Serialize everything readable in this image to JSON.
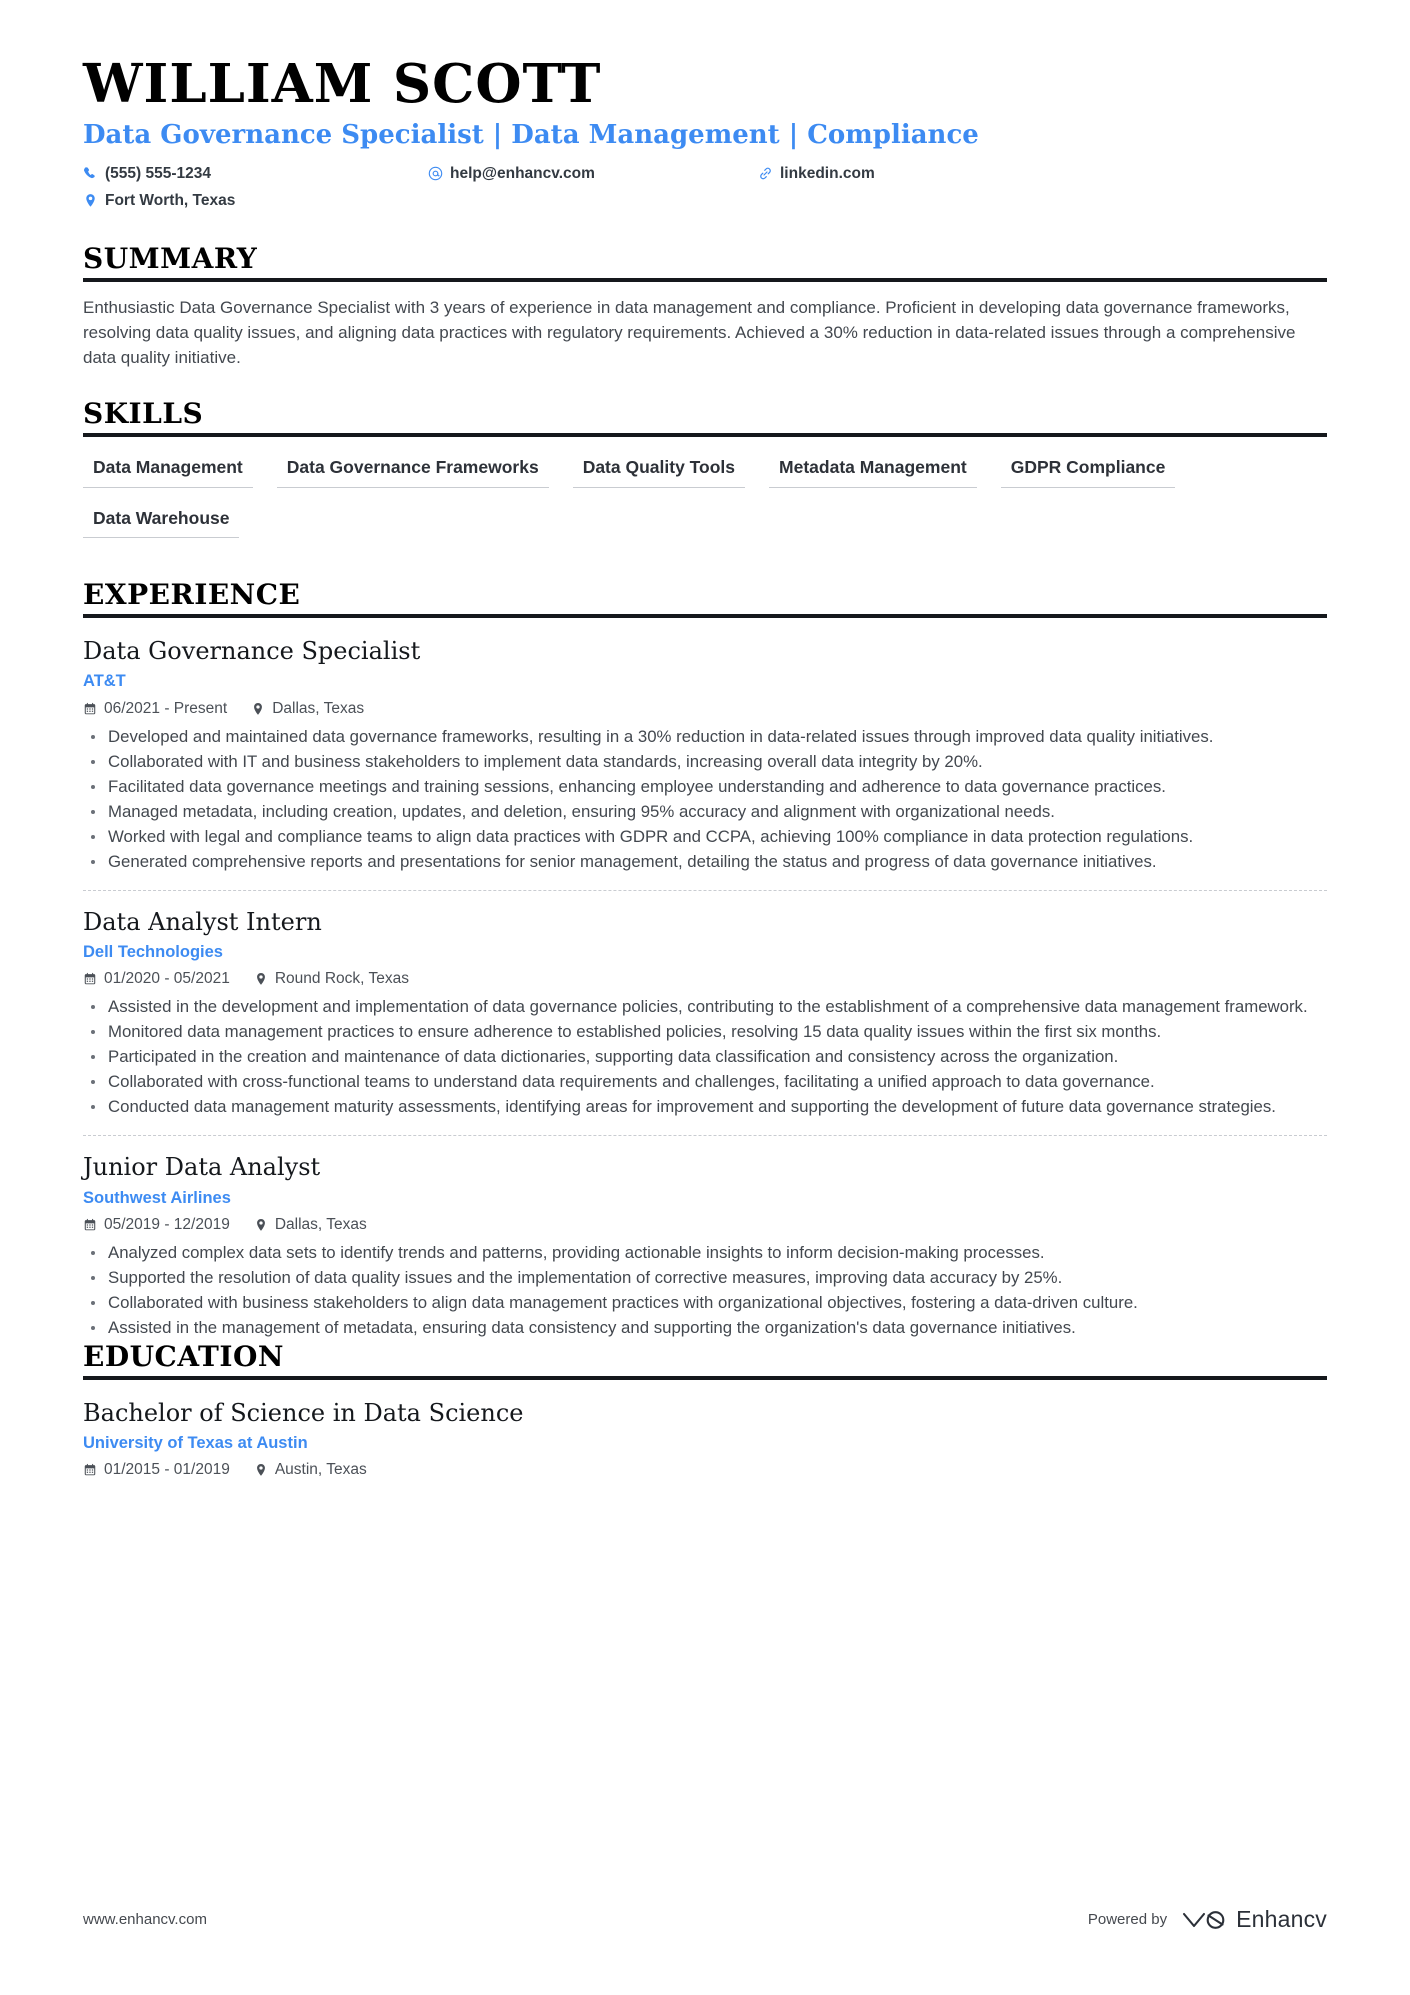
{
  "accent_color": "#3d8bf2",
  "text_color": "#43484f",
  "header": {
    "name": "WILLIAM SCOTT",
    "headline": "Data Governance Specialist | Data Management | Compliance",
    "contacts": [
      {
        "icon": "phone-icon",
        "label": "(555) 555-1234"
      },
      {
        "icon": "email-icon",
        "label": "help@enhancv.com"
      },
      {
        "icon": "link-icon",
        "label": "linkedin.com"
      },
      {
        "icon": "location-icon",
        "label": "Fort Worth, Texas"
      }
    ]
  },
  "sections": {
    "summary": {
      "title": "SUMMARY",
      "text": "Enthusiastic Data Governance Specialist with 3 years of experience in data management and compliance. Proficient in developing data governance frameworks, resolving data quality issues, and aligning data practices with regulatory requirements. Achieved a 30% reduction in data-related issues through a comprehensive data quality initiative."
    },
    "skills": {
      "title": "SKILLS",
      "items": [
        "Data Management",
        "Data Governance Frameworks",
        "Data Quality Tools",
        "Metadata Management",
        "GDPR Compliance",
        "Data Warehouse"
      ]
    },
    "experience": {
      "title": "EXPERIENCE",
      "entries": [
        {
          "title": "Data Governance Specialist",
          "organization": "AT&T",
          "dates": "06/2021 - Present",
          "location": "Dallas, Texas",
          "bullets": [
            "Developed and maintained data governance frameworks, resulting in a 30% reduction in data-related issues through improved data quality initiatives.",
            "Collaborated with IT and business stakeholders to implement data standards, increasing overall data integrity by 20%.",
            "Facilitated data governance meetings and training sessions, enhancing employee understanding and adherence to data governance practices.",
            "Managed metadata, including creation, updates, and deletion, ensuring 95% accuracy and alignment with organizational needs.",
            "Worked with legal and compliance teams to align data practices with GDPR and CCPA, achieving 100% compliance in data protection regulations.",
            "Generated comprehensive reports and presentations for senior management, detailing the status and progress of data governance initiatives."
          ]
        },
        {
          "title": "Data Analyst Intern",
          "organization": "Dell Technologies",
          "dates": "01/2020 - 05/2021",
          "location": "Round Rock, Texas",
          "bullets": [
            "Assisted in the development and implementation of data governance policies, contributing to the establishment of a comprehensive data management framework.",
            "Monitored data management practices to ensure adherence to established policies, resolving 15 data quality issues within the first six months.",
            "Participated in the creation and maintenance of data dictionaries, supporting data classification and consistency across the organization.",
            "Collaborated with cross-functional teams to understand data requirements and challenges, facilitating a unified approach to data governance.",
            "Conducted data management maturity assessments, identifying areas for improvement and supporting the development of future data governance strategies."
          ]
        },
        {
          "title": "Junior Data Analyst",
          "organization": "Southwest Airlines",
          "dates": "05/2019 - 12/2019",
          "location": "Dallas, Texas",
          "bullets": [
            "Analyzed complex data sets to identify trends and patterns, providing actionable insights to inform decision-making processes.",
            "Supported the resolution of data quality issues and the implementation of corrective measures, improving data accuracy by 25%.",
            "Collaborated with business stakeholders to align data management practices with organizational objectives, fostering a data-driven culture.",
            "Assisted in the management of metadata, ensuring data consistency and supporting the organization's data governance initiatives."
          ]
        }
      ]
    },
    "education": {
      "title": "EDUCATION",
      "entries": [
        {
          "title": "Bachelor of Science in Data Science",
          "organization": "University of Texas at Austin",
          "dates": "01/2015 - 01/2019",
          "location": "Austin, Texas"
        }
      ]
    }
  },
  "footer": {
    "url": "www.enhancv.com",
    "powered_by": "Powered by",
    "brand": "Enhancv"
  }
}
